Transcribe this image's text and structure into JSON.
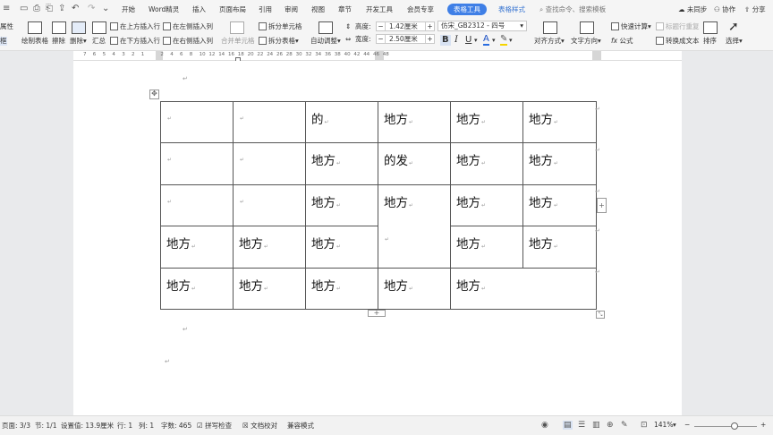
{
  "quick_access": {
    "icons": [
      "menu-icon",
      "save-icon",
      "print-icon",
      "print-preview-icon",
      "undo-icon",
      "redo-icon",
      "customize-icon"
    ]
  },
  "menu": {
    "items": [
      "开始",
      "Word精灵",
      "插入",
      "页面布局",
      "引用",
      "审阅",
      "视图",
      "章节",
      "开发工具",
      "会员专享"
    ],
    "table_tools": "表格工具",
    "table_style": "表格样式",
    "search_placeholder": "查找命令、搜索模板",
    "sync": "未同步",
    "collab": "协作",
    "share": "分享"
  },
  "ribbon": {
    "attr_top": "属性",
    "attr_bottom": "框",
    "draw_table": "绘制表格",
    "erase": "擦除",
    "delete": "删除",
    "summary": "汇总",
    "insert_above": "在上方插入行",
    "insert_below": "在下方插入行",
    "insert_left": "在左侧插入列",
    "insert_right": "在右侧插入列",
    "merge_cells": "合并单元格",
    "split_cells": "拆分单元格",
    "split_table": "拆分表格",
    "auto_fit": "自动调整",
    "height_label": "高度:",
    "height_value": "1.42厘米",
    "width_label": "宽度:",
    "width_value": "2.50厘米",
    "font_name": "仿宋_GB2312",
    "font_size": "四号",
    "bold": "B",
    "italic": "I",
    "underline": "U",
    "font_color": "A",
    "align": "对齐方式",
    "text_dir": "文字方向",
    "quick_calc": "快速计算",
    "repeat_header": "标题行重复",
    "formula": "公式",
    "to_text": "转换成文本",
    "sort": "排序",
    "select": "选择"
  },
  "ruler": {
    "labels": [
      "7",
      "6",
      "5",
      "4",
      "3",
      "2",
      "1",
      "",
      "2",
      "4",
      "6",
      "8",
      "10",
      "12",
      "14",
      "16",
      "18",
      "20",
      "22",
      "24",
      "26",
      "28",
      "30",
      "32",
      "34",
      "36",
      "38",
      "40",
      "42",
      "44",
      "46",
      "48"
    ]
  },
  "table": {
    "cells": {
      "r0c2": "的",
      "r0c3": "地方",
      "r0c4": "地方",
      "r0c5": "地方",
      "r1c2": "地方",
      "r1c3": "的发",
      "r1c4": "地方",
      "r1c5": "地方",
      "r2c2": "地方",
      "r2c3": "地方",
      "r2c4": "地方",
      "r2c5": "地方",
      "r3c0": "地方",
      "r3c1": "地方",
      "r3c2": "地方",
      "r3c4": "地方",
      "r3c5": "地方",
      "r4c0": "地方",
      "r4c1": "地方",
      "r4c2": "地方",
      "r4c3": "地方",
      "r4c4": "地方"
    },
    "para_mark": "↵"
  },
  "status": {
    "page": "页面: 3/3",
    "section": "节: 1/1",
    "setting": "设置值: 13.9厘米",
    "row": "行: 1",
    "col": "列: 1",
    "words": "字数: 465",
    "spell": "拼写检查",
    "proof": "文档校对",
    "compat": "兼容模式",
    "zoom": "141%"
  }
}
